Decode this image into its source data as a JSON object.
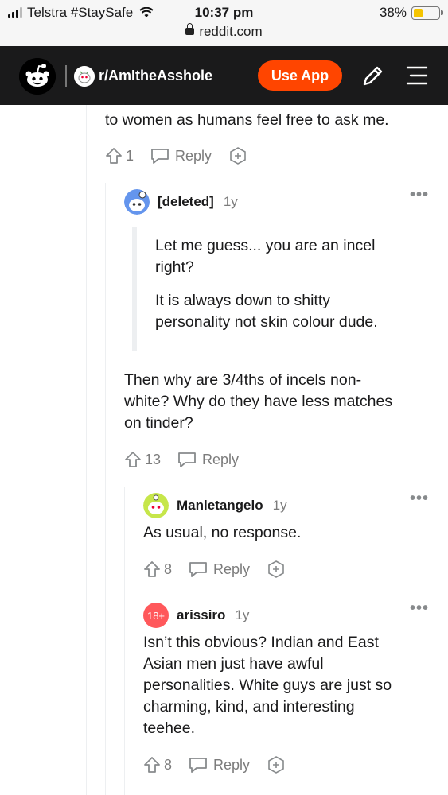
{
  "status_bar": {
    "carrier": "Telstra #StaySafe",
    "time": "10:37 pm",
    "battery": "38%",
    "battery_level": 0.38
  },
  "browser": {
    "url": "reddit.com"
  },
  "header": {
    "subreddit": "r/AmItheAsshole",
    "use_app_label": "Use App",
    "accent": "#ff4500"
  },
  "comments": [
    {
      "text_lines": [
        "to women as humans feel free to ask me."
      ],
      "votes": "1",
      "reply_label": "Reply"
    },
    {
      "author": "[deleted]",
      "age": "1y",
      "quote": [
        "Let me guess... you are an incel",
        "right?",
        "It is always down to shitty",
        "personality not skin colour dude."
      ],
      "body": [
        "Then why are 3/4ths of incels non-",
        "white? Why do they have less matches",
        "on tinder?"
      ],
      "votes": "13",
      "reply_label": "Reply"
    },
    {
      "author": "Manletangelo",
      "age": "1y",
      "body": [
        "As usual, no response."
      ],
      "votes": "8",
      "reply_label": "Reply"
    },
    {
      "author": "arissiro",
      "age": "1y",
      "badge": "18+",
      "body": [
        "Isn’t this obvious? Indian and East",
        "Asian men just have awful",
        "personalities. White guys are just so",
        "charming, kind, and interesting",
        "teehee."
      ],
      "votes": "8",
      "reply_label": "Reply"
    }
  ]
}
